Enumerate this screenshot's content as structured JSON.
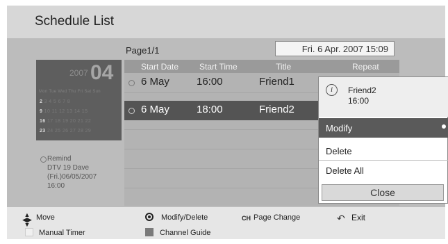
{
  "header": {
    "title": "Schedule List"
  },
  "page": {
    "label": "Page1/1",
    "datetime": "Fri. 6 Apr. 2007 15:09"
  },
  "calendar": {
    "year": "2007",
    "month": "04",
    "days_header": "Mon Tue Wed Thu Fri Sat Sun",
    "weeks": [
      {
        "first": "2",
        "rest": "3  4  5  6  7  8"
      },
      {
        "first": "9",
        "rest": "10  11  12  13  14  15"
      },
      {
        "first": "16",
        "rest": "17  18  19  20  21  22"
      },
      {
        "first": "23",
        "rest": "24  25  26  27  28  29"
      }
    ]
  },
  "remind": {
    "label": "Remind",
    "channel": "DTV 19 Dave",
    "date": "(Fri.)06/05/2007",
    "time": "16:00"
  },
  "table": {
    "columns": [
      "Start Date",
      "Start Time",
      "Title",
      "Repeat"
    ],
    "rows": [
      {
        "date": "6 May",
        "time": "16:00",
        "title": "Friend1",
        "selected": false
      },
      {
        "date": "6 May",
        "time": "18:00",
        "title": "Friend2",
        "selected": true
      }
    ]
  },
  "popup": {
    "info_icon": "i",
    "name": "Friend2",
    "time": "16:00",
    "menu": [
      "Modify",
      "Delete",
      "Delete All"
    ],
    "close": "Close"
  },
  "footer": {
    "move": "Move",
    "modify_delete": "Modify/Delete",
    "ch_icon": "CH",
    "page_change": "Page Change",
    "exit": "Exit",
    "manual_timer": "Manual Timer",
    "channel_guide": "Channel Guide"
  },
  "icons": {
    "move": "four-way-arrows-icon",
    "ok": "ok-button-icon",
    "channel": "channel-updown-icon",
    "exit": "exit-return-icon",
    "clock": "clock-icon",
    "info": "info-icon"
  },
  "colors": {
    "panel": "#e6e6e6",
    "main_area": "#bcbcbc",
    "selected_row": "#545454",
    "highlight_menu": "#5a5a5a",
    "manual_timer_swatch": "#f0f0f0",
    "channel_guide_swatch": "#7a7a7a"
  }
}
